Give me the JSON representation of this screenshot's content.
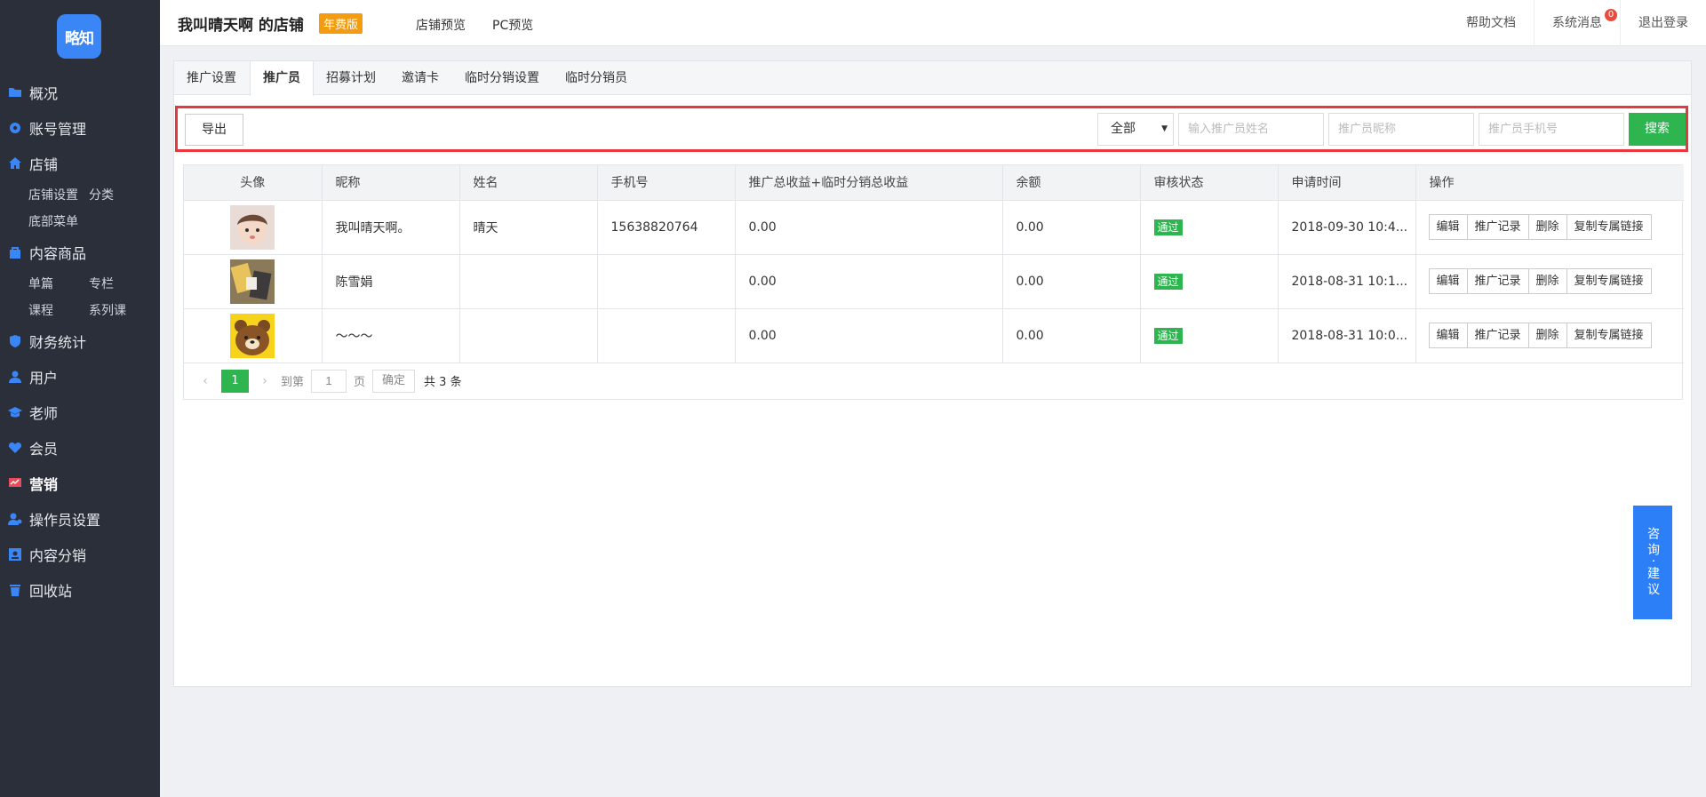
{
  "logo": {
    "text": "略知"
  },
  "sidebar": {
    "items": [
      {
        "label": "概况",
        "icon": "folder-icon"
      },
      {
        "label": "账号管理",
        "icon": "gear-icon"
      },
      {
        "label": "店铺",
        "icon": "home-icon"
      },
      {
        "label": "内容商品",
        "icon": "bag-icon"
      },
      {
        "label": "财务统计",
        "icon": "shield-icon"
      },
      {
        "label": "用户",
        "icon": "user-icon"
      },
      {
        "label": "老师",
        "icon": "graduation-cap-icon"
      },
      {
        "label": "会员",
        "icon": "heart-icon"
      },
      {
        "label": "营销",
        "icon": "chart-icon"
      },
      {
        "label": "操作员设置",
        "icon": "user-gear-icon"
      },
      {
        "label": "内容分销",
        "icon": "share-icon"
      },
      {
        "label": "回收站",
        "icon": "trash-icon"
      }
    ],
    "store_sub": [
      "店铺设置",
      "分类",
      "底部菜单"
    ],
    "content_sub": [
      "单篇",
      "专栏",
      "课程",
      "系列课"
    ],
    "accent": "#3a86f7",
    "active_icon_color": "#e94b5a"
  },
  "topbar": {
    "store_title": "我叫晴天啊 的店铺",
    "plan_badge": "年费版",
    "preview_store": "店铺预览",
    "preview_pc": "PC预览",
    "help": "帮助文档",
    "messages": "系统消息",
    "message_count": "0",
    "logout": "退出登录"
  },
  "tabs": [
    "推广设置",
    "推广员",
    "招募计划",
    "邀请卡",
    "临时分销设置",
    "临时分销员"
  ],
  "filters": {
    "export_label": "导出",
    "select_value": "全部",
    "name_placeholder": "输入推广员姓名",
    "nickname_placeholder": "推广员昵称",
    "phone_placeholder": "推广员手机号",
    "search_label": "搜索"
  },
  "table": {
    "headers": [
      "头像",
      "昵称",
      "姓名",
      "手机号",
      "推广总收益+临时分销总收益",
      "余额",
      "审核状态",
      "申请时间",
      "操作"
    ],
    "rows": [
      {
        "nickname": "我叫晴天啊。",
        "name": "晴天",
        "phone": "15638820764",
        "income": "0.00",
        "balance": "0.00",
        "status": "通过",
        "time": "2018-09-30 10:4..."
      },
      {
        "nickname": "陈雪娟",
        "name": "",
        "phone": "",
        "income": "0.00",
        "balance": "0.00",
        "status": "通过",
        "time": "2018-08-31 10:1..."
      },
      {
        "nickname": "～～～",
        "name": "",
        "phone": "",
        "income": "0.00",
        "balance": "0.00",
        "status": "通过",
        "time": "2018-08-31 10:0..."
      }
    ],
    "ops": [
      "编辑",
      "推广记录",
      "删除",
      "复制专属链接"
    ]
  },
  "pager": {
    "current": "1",
    "goto_label": "到第",
    "goto_value": "1",
    "page_label": "页",
    "ok_label": "确定",
    "total": "共 3 条"
  },
  "consult": "咨询·建议"
}
